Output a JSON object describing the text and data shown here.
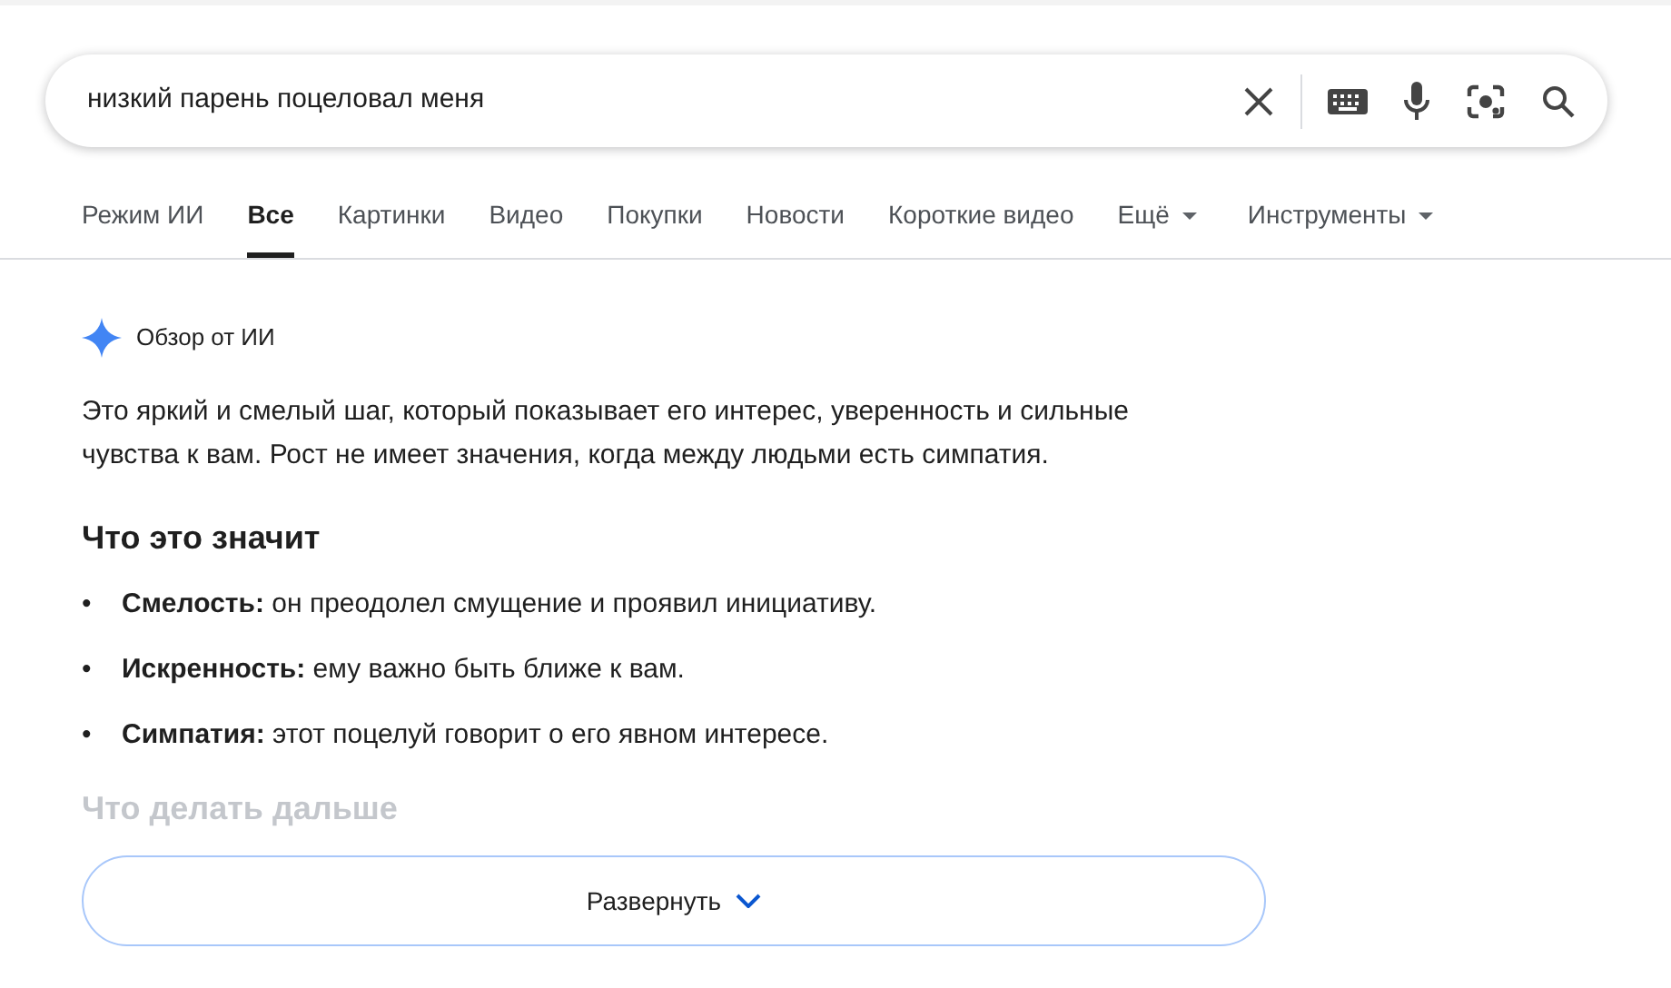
{
  "search": {
    "value": "низкий парень поцеловал меня"
  },
  "tabs": [
    {
      "label": "Режим ИИ",
      "selected": false,
      "kind": "tab"
    },
    {
      "label": "Все",
      "selected": true,
      "kind": "tab"
    },
    {
      "label": "Картинки",
      "selected": false,
      "kind": "tab"
    },
    {
      "label": "Видео",
      "selected": false,
      "kind": "tab"
    },
    {
      "label": "Покупки",
      "selected": false,
      "kind": "tab"
    },
    {
      "label": "Новости",
      "selected": false,
      "kind": "tab"
    },
    {
      "label": "Короткие видео",
      "selected": false,
      "kind": "tab"
    },
    {
      "label": "Ещё",
      "selected": false,
      "kind": "menu"
    },
    {
      "label": "Инструменты",
      "selected": false,
      "kind": "menu"
    }
  ],
  "ai_overview": {
    "title": "Обзор от ИИ",
    "summary": "Это яркий и смелый шаг, который показывает его интерес, уверенность и сильные чувства к вам. Рост не имеет значения, когда между людьми есть симпатия.",
    "sections": [
      {
        "heading": "Что это значит",
        "faded": false,
        "bullets": [
          {
            "marker": "•",
            "text": "**Смелость:** он преодолел смущение и проявил инициативу."
          },
          {
            "marker": "•",
            "text": "**Искренность:** ему важно быть ближе к вам."
          },
          {
            "marker": "•",
            "text": "**Симпатия:** этот поцелуй говорит о его явном интересе."
          }
        ]
      },
      {
        "heading": "Что делать дальше",
        "faded": true
      }
    ],
    "expand_button": "Развернуть"
  }
}
